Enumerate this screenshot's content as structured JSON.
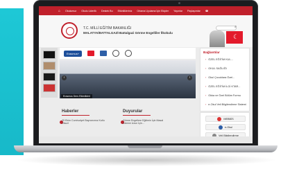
{
  "nav": {
    "home_icon": "⌂",
    "items": [
      "Okulumuz",
      "Okulu Liderlik",
      "Destek Bu",
      "Etkinlikleriniz",
      "Ortama Uyulama İçin Ekipler",
      "Yayınlar",
      "Paylaşımlar"
    ],
    "phone_icon": "☎"
  },
  "header": {
    "line1": "T.C. MİLLİ EĞİTİM BAKANLIĞI",
    "line2": "MALATYA/BATTALGAZİ-Battalgazi Görme Engelliler İlkokulu",
    "search_placeholder": "Ara..."
  },
  "banner": {
    "erasmus": "Erasmus+"
  },
  "photo": {
    "caption": "Erasmus Ders Etkinlikleri"
  },
  "quicklinks": {
    "title": "Bağlantılar",
    "items": [
      "ÖZEL EĞİTİM KUL...",
      "OKUL SAĞLIĞI",
      "Okul Çocuklara Özel...",
      "ÖZEL EĞİTİM İLGİ KTAR...",
      "Okka ve Özel Bölüm Formu",
      "e-Okul Veli Bilgilendirme Sistemi"
    ]
  },
  "news": {
    "title": "Haberler",
    "item": "29 Ekim Cumhuriyet Bayramımız Kutlu Olsun!"
  },
  "announcements": {
    "title": "Duyurular",
    "item": "Görme Engellere Eğitimin İçin Masal Edinimi Uzun İçin..."
  },
  "sidebar_buttons": [
    {
      "label": "MEBBİS"
    },
    {
      "label": "e-Okul"
    },
    {
      "label": "Veli Bilgilendirme"
    }
  ],
  "colors": {
    "primary_red": "#c0202b",
    "cyan_band": "#1ec8d6"
  }
}
